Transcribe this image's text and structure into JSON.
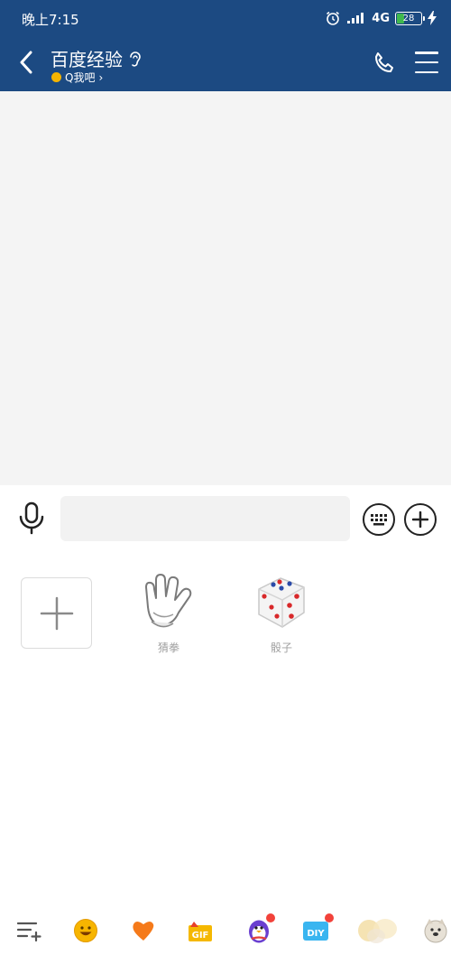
{
  "status_bar": {
    "time": "晚上7:15",
    "network": "4G",
    "battery": 28,
    "battery_label": "28"
  },
  "header": {
    "title": "百度经验",
    "subtitle": "Q我吧",
    "subtitle_chevron": "›"
  },
  "input": {
    "value": "",
    "placeholder": ""
  },
  "sticker_panel": {
    "items": [
      {
        "label": "猜拳",
        "icon": "rock-paper-scissors-hand-icon"
      },
      {
        "label": "骰子",
        "icon": "dice-icon"
      }
    ]
  },
  "tab_bar": {
    "tabs": [
      {
        "icon": "sticker-list-add-icon",
        "badge": false
      },
      {
        "icon": "smiley-emoji-icon",
        "badge": false
      },
      {
        "icon": "heart-favorites-icon",
        "badge": false
      },
      {
        "icon": "gif-icon",
        "badge": false
      },
      {
        "icon": "penguin-sticker-icon",
        "badge": true
      },
      {
        "icon": "diy-sticker-icon",
        "badge": true
      },
      {
        "icon": "blurred-sticker-icon",
        "badge": false
      },
      {
        "icon": "doge-sticker-icon",
        "badge": false
      }
    ]
  },
  "colors": {
    "header_bg": "#1c4a82",
    "chat_bg": "#f4f4f4",
    "badge": "#f2423a"
  }
}
